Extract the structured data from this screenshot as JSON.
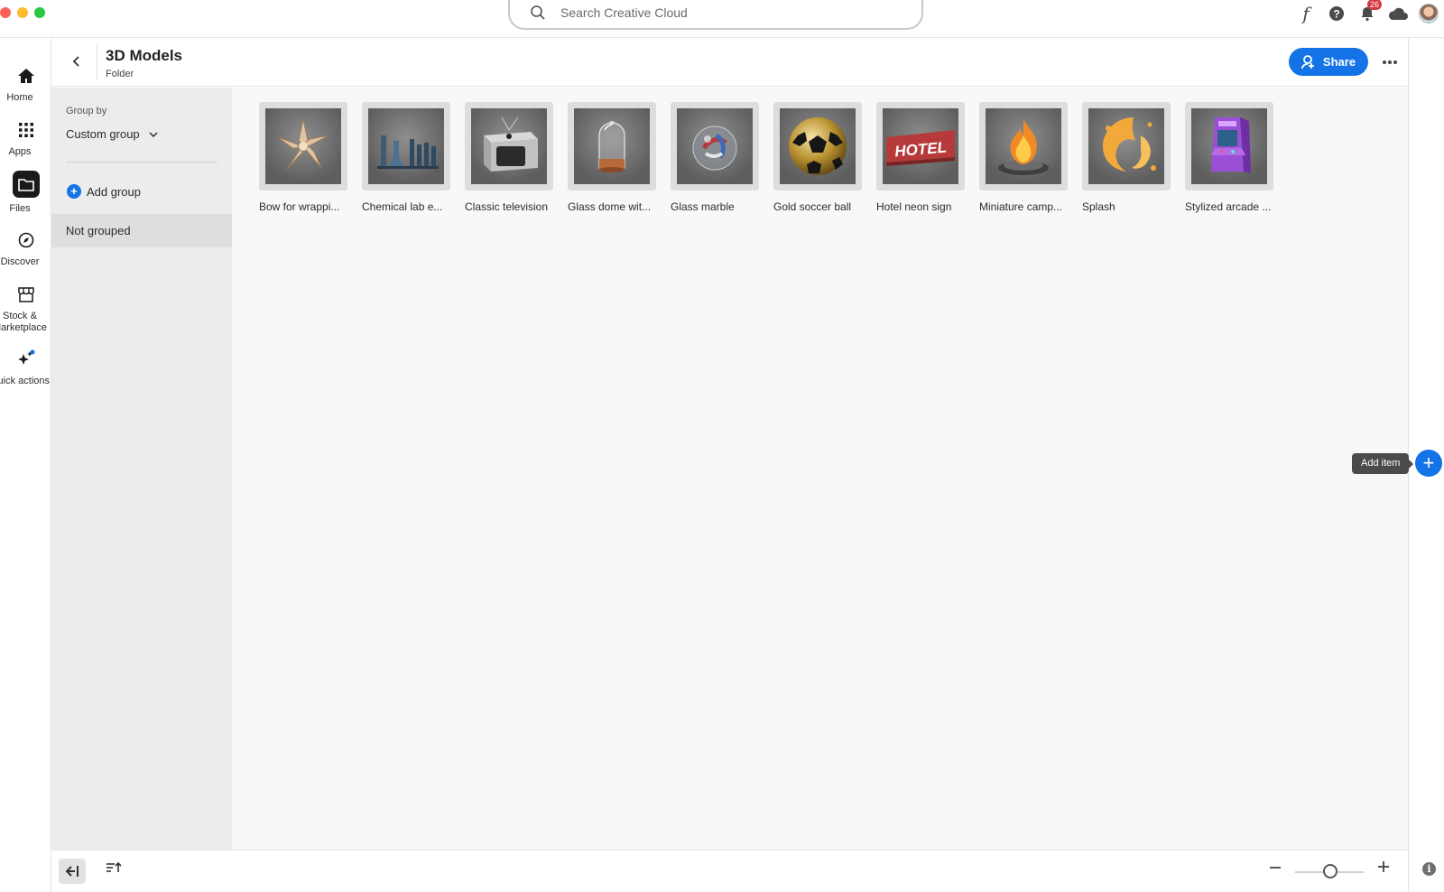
{
  "search": {
    "placeholder": "Search Creative Cloud"
  },
  "notifications": {
    "count": "26"
  },
  "nav": {
    "home": "Home",
    "apps": "Apps",
    "files": "Files",
    "discover": "Discover",
    "stock_line1": "Stock &",
    "stock_line2": "Marketplace",
    "quick_actions": "Quick actions"
  },
  "header": {
    "title": "3D Models",
    "subtitle": "Folder",
    "share_label": "Share"
  },
  "group_panel": {
    "group_by_label": "Group by",
    "group_by_value": "Custom group",
    "add_group_label": "Add group",
    "not_grouped_label": "Not grouped"
  },
  "items": [
    {
      "name": "Bow for wrappi..."
    },
    {
      "name": "Chemical lab e..."
    },
    {
      "name": "Classic television"
    },
    {
      "name": "Glass dome wit..."
    },
    {
      "name": "Glass marble"
    },
    {
      "name": "Gold soccer ball"
    },
    {
      "name": "Hotel neon sign"
    },
    {
      "name": "Miniature camp..."
    },
    {
      "name": "Splash"
    },
    {
      "name": "Stylized arcade ..."
    }
  ],
  "hotel_sign_text": "HOTEL",
  "add_item": {
    "tooltip": "Add item"
  },
  "colors": {
    "accent": "#1473e6",
    "badge": "#d7373f"
  }
}
